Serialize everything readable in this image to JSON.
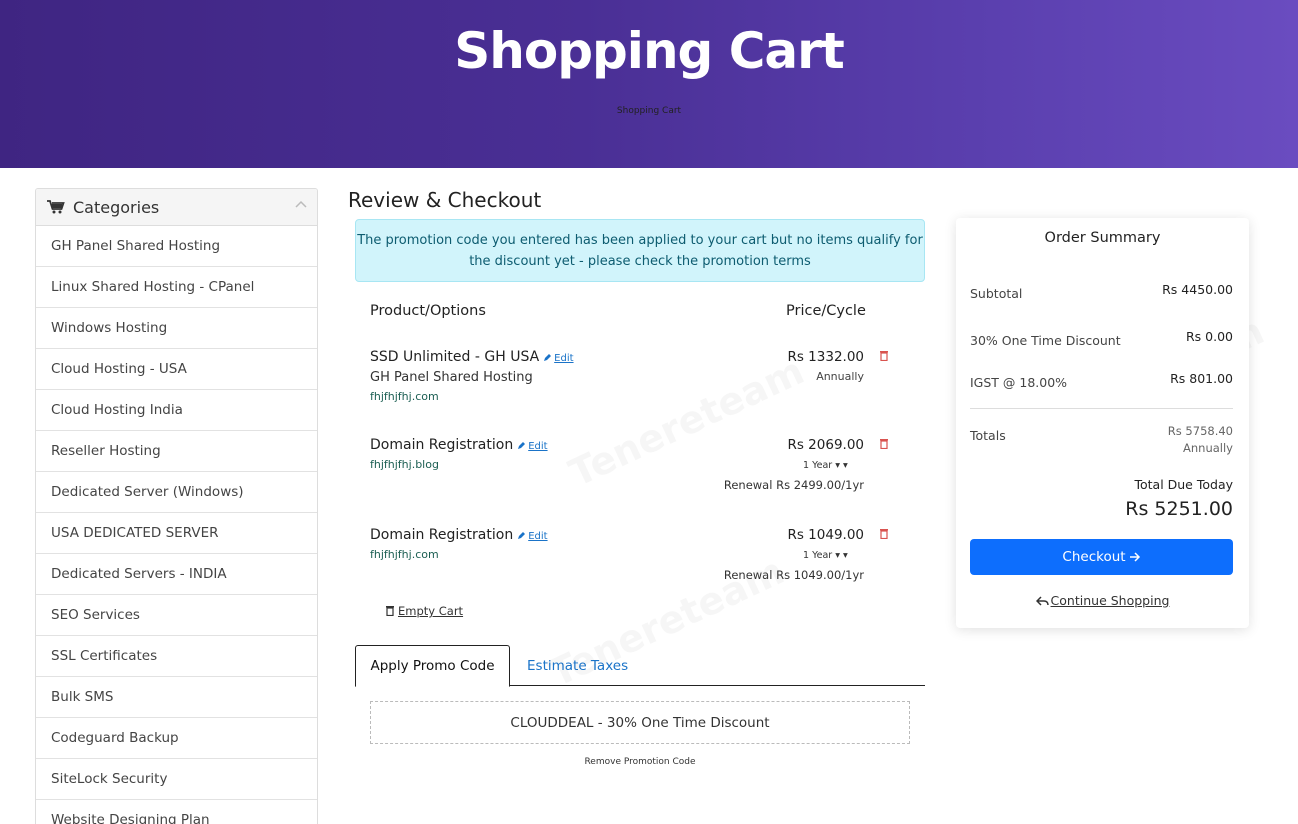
{
  "header": {
    "title": "Shopping Cart",
    "breadcrumb": "Shopping Cart"
  },
  "sidebar": {
    "title": "Categories",
    "items": [
      "GH Panel Shared Hosting",
      "Linux Shared Hosting - CPanel",
      "Windows Hosting",
      "Cloud Hosting - USA",
      "Cloud Hosting India",
      "Reseller Hosting",
      "Dedicated Server (Windows)",
      "USA DEDICATED SERVER",
      "Dedicated Servers - INDIA",
      "SEO Services",
      "SSL Certificates",
      "Bulk SMS",
      "Codeguard Backup",
      "SiteLock Security",
      "Website Designing Plan"
    ]
  },
  "main": {
    "title": "Review & Checkout",
    "alert": "The promotion code you entered has been applied to your cart but no items qualify for the discount yet - please check the promotion terms",
    "col_product": "Product/Options",
    "col_price": "Price/Cycle",
    "edit_label": "Edit",
    "items": [
      {
        "name": "SSD Unlimited - GH USA",
        "group": "GH Panel Shared Hosting",
        "domain": "fhjfhjfhj.com",
        "price": "Rs 1332.00",
        "cycle": "Annually"
      },
      {
        "name": "Domain Registration",
        "domain": "fhjfhjfhj.blog",
        "price": "Rs 2069.00",
        "cycle": "1 Year",
        "renewal": "Renewal Rs 2499.00/1yr"
      },
      {
        "name": "Domain Registration",
        "domain": "fhjfhjfhj.com",
        "price": "Rs 1049.00",
        "cycle": "1 Year",
        "renewal": "Renewal Rs 1049.00/1yr"
      }
    ],
    "empty_cart": "Empty Cart",
    "tabs": {
      "promo": "Apply Promo Code",
      "taxes": "Estimate Taxes"
    },
    "promo_code": "CLOUDDEAL - 30% One Time Discount",
    "remove_promo": "Remove Promotion Code"
  },
  "summary": {
    "title": "Order Summary",
    "subtotal_label": "Subtotal",
    "subtotal": "Rs 4450.00",
    "discount_label": "30% One Time Discount",
    "discount": "Rs 0.00",
    "tax_label": "IGST @ 18.00%",
    "tax": "Rs 801.00",
    "totals_label": "Totals",
    "totals": "Rs 5758.40",
    "totals_cycle": "Annually",
    "due_label": "Total Due Today",
    "due": "Rs 5251.00",
    "checkout": "Checkout",
    "continue": "Continue Shopping"
  },
  "colors": {
    "header": "#4a2f95",
    "accent": "#0d6efd",
    "alert_bg": "#d1f4fb",
    "trash": "#d9534f"
  }
}
